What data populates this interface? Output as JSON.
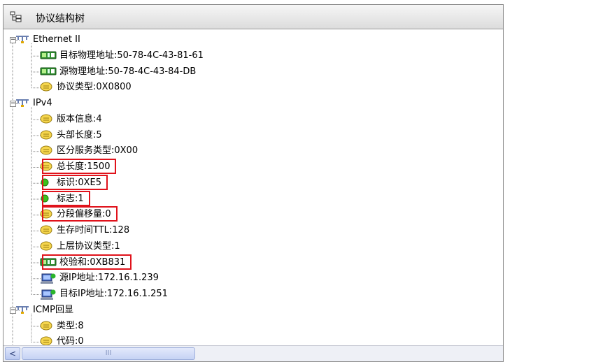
{
  "panel": {
    "title": "协议结构树",
    "title_icon": "tree-structure-icon"
  },
  "tree": [
    {
      "id": "eth",
      "label": "Ethernet II",
      "icon": "network-node-icon",
      "expanded": true,
      "expander": "−",
      "children": [
        {
          "label": "目标物理地址:50-78-4C-43-81-61",
          "icon": "green-card-icon"
        },
        {
          "label": "源物理地址:50-78-4C-43-84-DB",
          "icon": "green-card-icon"
        },
        {
          "label": "协议类型:0X0800",
          "icon": "yellow-field-icon"
        }
      ]
    },
    {
      "id": "ipv4",
      "label": "IPv4",
      "icon": "network-node-icon",
      "expanded": true,
      "expander": "−",
      "children": [
        {
          "label": "版本信息:4",
          "icon": "yellow-field-icon"
        },
        {
          "label": "头部长度:5",
          "icon": "yellow-field-icon"
        },
        {
          "label": "区分服务类型:0X00",
          "icon": "yellow-field-icon"
        },
        {
          "label": "总长度:1500",
          "icon": "yellow-field-icon",
          "highlight": true
        },
        {
          "label": "标识:0XE5",
          "icon": "green-dot-icon",
          "highlight": true
        },
        {
          "label": "标志:1",
          "icon": "green-dot-icon",
          "highlight": true
        },
        {
          "label": "分段偏移量:0",
          "icon": "yellow-field-icon",
          "highlight": true
        },
        {
          "label": "生存时间TTL:128",
          "icon": "yellow-field-icon"
        },
        {
          "label": "上层协议类型:1",
          "icon": "yellow-field-icon"
        },
        {
          "label": "校验和:0XB831",
          "icon": "green-card-icon",
          "highlight": true
        },
        {
          "label": "源IP地址:172.16.1.239",
          "icon": "computer-icon"
        },
        {
          "label": "目标IP地址:172.16.1.251",
          "icon": "computer-icon"
        }
      ]
    },
    {
      "id": "icmp",
      "label": "ICMP回显",
      "icon": "network-node-icon",
      "expanded": true,
      "expander": "−",
      "children": [
        {
          "label": "类型:8",
          "icon": "yellow-field-icon"
        },
        {
          "label": "代码:0",
          "icon": "yellow-field-icon"
        }
      ]
    }
  ],
  "scrollbar": {
    "left_arrow": "<",
    "thumb_grip": "III"
  },
  "colors": {
    "highlight_border": "#e0121b",
    "tree_line": "#8a8a8a"
  }
}
